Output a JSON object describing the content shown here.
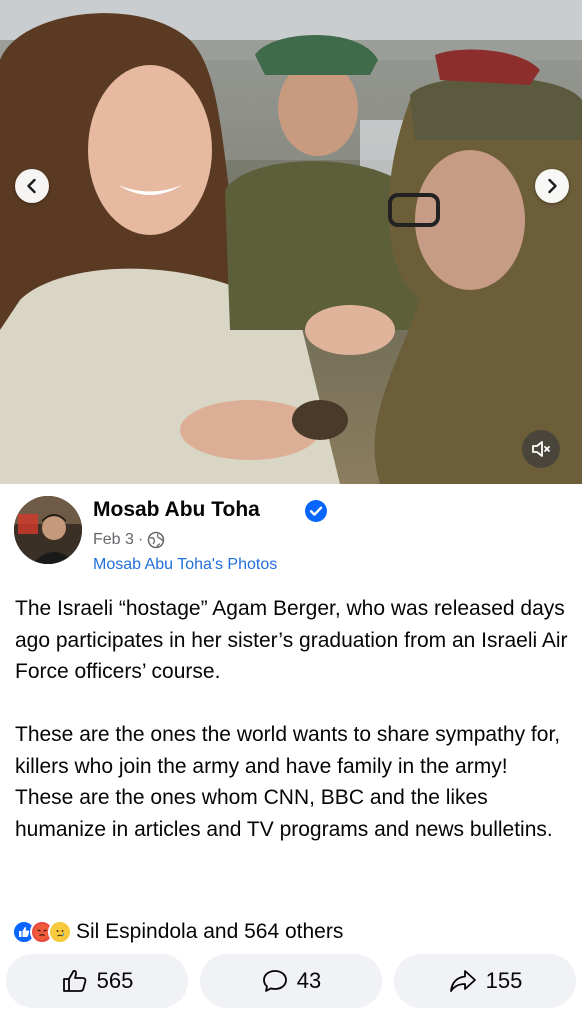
{
  "colors": {
    "link": "#216fdb",
    "secondary_text": "#65676b",
    "verified": "#0866ff",
    "pill_bg": "#f0f2f5"
  },
  "media": {
    "prev_icon": "chevron-left-icon",
    "next_icon": "chevron-right-icon",
    "mute_icon": "speaker-muted-icon"
  },
  "post": {
    "author": "Mosab Abu Toha",
    "verified_icon": "verified-badge-icon",
    "date": "Feb 3",
    "separator": "·",
    "audience_icon": "globe-icon",
    "source": "Mosab Abu Toha's Photos",
    "paragraph_1": "The Israeli “hostage” Agam Berger, who was released days ago participates in her sister’s graduation from an Israeli Air Force officers’ course.",
    "paragraph_2": "These are the ones the world wants to share sympathy for, killers who join the army and have family in the army!",
    "paragraph_3": "These are the ones whom CNN, BBC and the likes humanize in articles and TV programs and news bulletins."
  },
  "reactions": {
    "icons": [
      "like-reaction-icon",
      "angry-reaction-icon",
      "sad-reaction-icon"
    ],
    "summary": "Sil Espindola and 564 others"
  },
  "actions": {
    "like_count": "565",
    "comment_count": "43",
    "share_count": "155"
  }
}
